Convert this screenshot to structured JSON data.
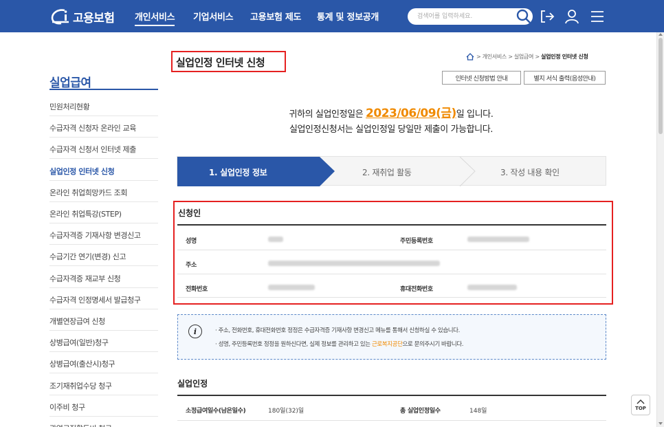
{
  "header": {
    "brand": "고용보험",
    "nav": [
      "개인서비스",
      "기업서비스",
      "고용보험 제도",
      "통계 및 정보공개"
    ],
    "search_placeholder": "검색어를 입력하세요."
  },
  "sidebar": {
    "title": "실업급여",
    "items": [
      "민원처리현황",
      "수급자격 신청자 온라인 교육",
      "수급자격 신청서 인터넷 제출",
      "실업인정 인터넷 신청",
      "온라인 취업희망카드 조회",
      "온라인 취업특강(STEP)",
      "수급자격증 기재사항 변경신고",
      "수급기간 연기(변경) 신고",
      "수급자격증 재교부 신청",
      "수급자격 인정명세서 발급청구",
      "개별연장급여 신청",
      "상병급여(일반)청구",
      "상병급여(출산시)청구",
      "조기재취업수당 청구",
      "이주비 청구",
      "광역구직활동비 청구"
    ],
    "active_index": 3
  },
  "breadcrumb": {
    "items": [
      "개인서비스",
      "실업급여"
    ],
    "current": "실업인정 인터넷 신청",
    "separator": ">"
  },
  "page": {
    "title": "실업인정 인터넷 신청",
    "btn_guide": "인터넷 신청방법 안내",
    "btn_print": "별지 서식 출력(음성안내)"
  },
  "notice": {
    "line1_pre": "귀하의 실업인정일은 ",
    "date": "2023/06/09(금)",
    "line1_post": "일 입니다.",
    "line2": "실업인정신청서는 실업인정일 당일만 제출이 가능합니다."
  },
  "steps": [
    "1. 실업인정 정보",
    "2. 재취업 활동",
    "3. 작성 내용 확인"
  ],
  "applicant": {
    "title": "신청인",
    "labels": {
      "name": "성명",
      "rrn": "주민등록번호",
      "address": "주소",
      "phone": "전화번호",
      "mobile": "휴대전화번호"
    }
  },
  "info": {
    "line1": "· 주소, 전화번호, 휴대전화번호 정정은 수급자격증 기재사항 변경신고 메뉴를 통해서 신청하실 수 있습니다.",
    "line2_pre": "· 성명, 주민등록번호 정정을 원하신다면, 실제 정보를 관리하고 있는 ",
    "line2_hl": "근로복지공단",
    "line2_post": "으로 문의주시기 바랍니다."
  },
  "recognition": {
    "title": "실업인정",
    "label1": "소정급여일수(남은일수)",
    "value1": "180일(32)일",
    "label2": "총 실업인정일수",
    "value2": "148일"
  },
  "top_button": "TOP",
  "colors": {
    "header_bg": "#2a57a8",
    "accent": "#2a57a8",
    "highlight": "#f08a00",
    "outline_red": "#e52020"
  }
}
